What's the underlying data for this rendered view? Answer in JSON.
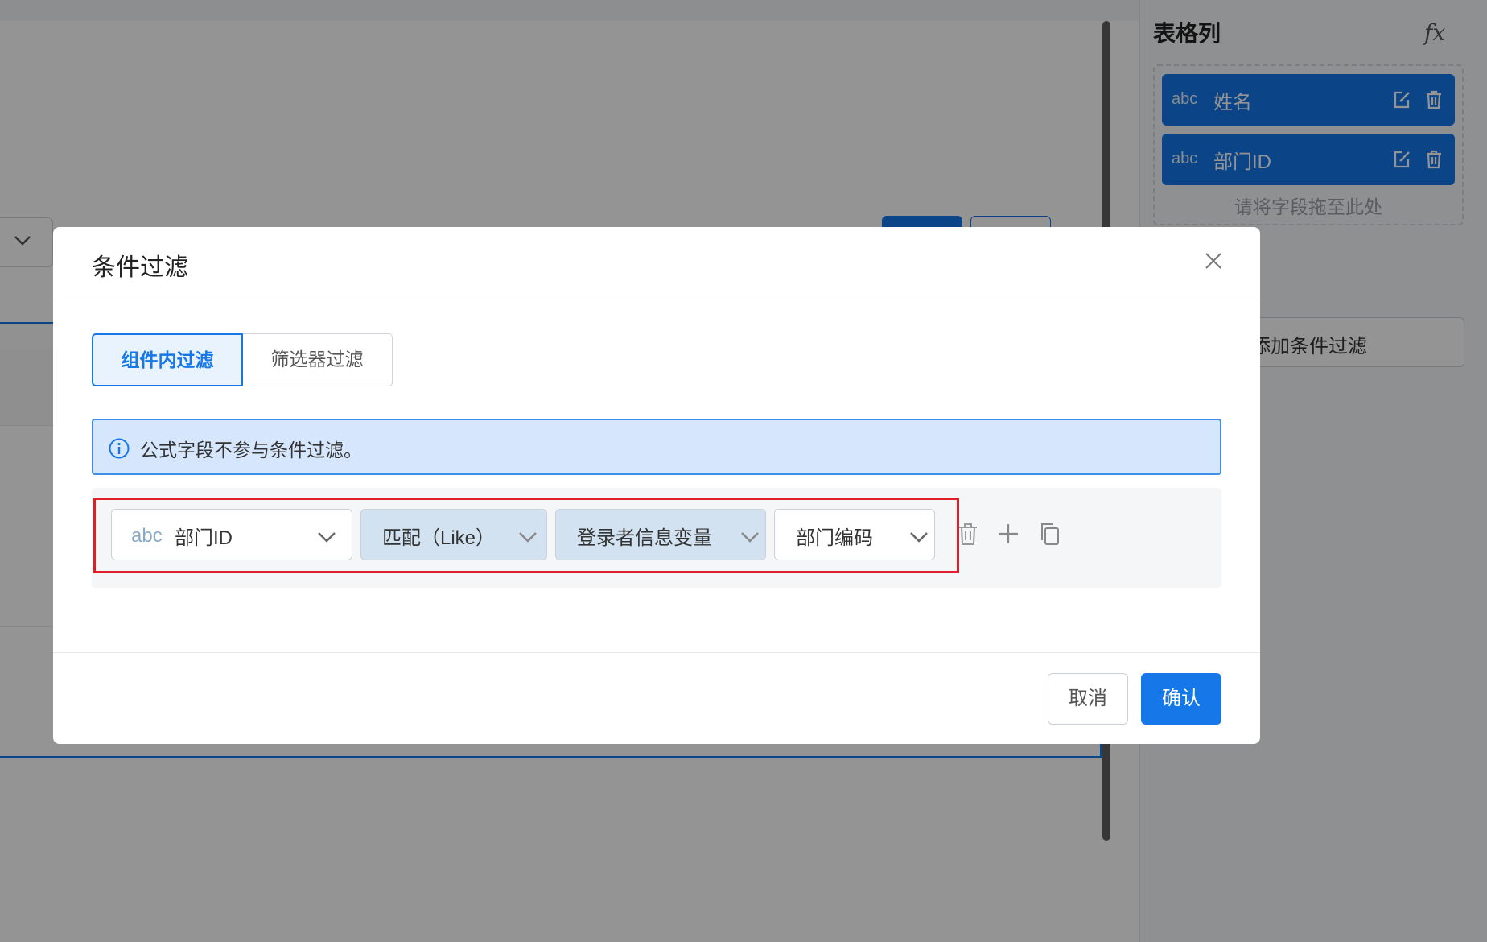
{
  "panel": {
    "title": "表格列",
    "fx_label": "fx",
    "columns": [
      {
        "type": "abc",
        "name": "姓名"
      },
      {
        "type": "abc",
        "name": "部门ID"
      }
    ],
    "drop_hint": "请将字段拖至此处",
    "add_filter": "添加条件过滤"
  },
  "modal": {
    "title": "条件过滤",
    "tabs": [
      "组件内过滤",
      "筛选器过滤"
    ],
    "active_tab": "组件内过滤",
    "info": "公式字段不参与条件过滤。",
    "condition": {
      "field_type": "abc",
      "field": "部门ID",
      "operator": "匹配（Like）",
      "value_source": "登录者信息变量",
      "value": "部门编码"
    },
    "cancel": "取消",
    "confirm": "确认"
  },
  "colors": {
    "primary": "#1677e8",
    "highlight_border": "#e01e2a",
    "info_bg": "#d6e7fd"
  }
}
